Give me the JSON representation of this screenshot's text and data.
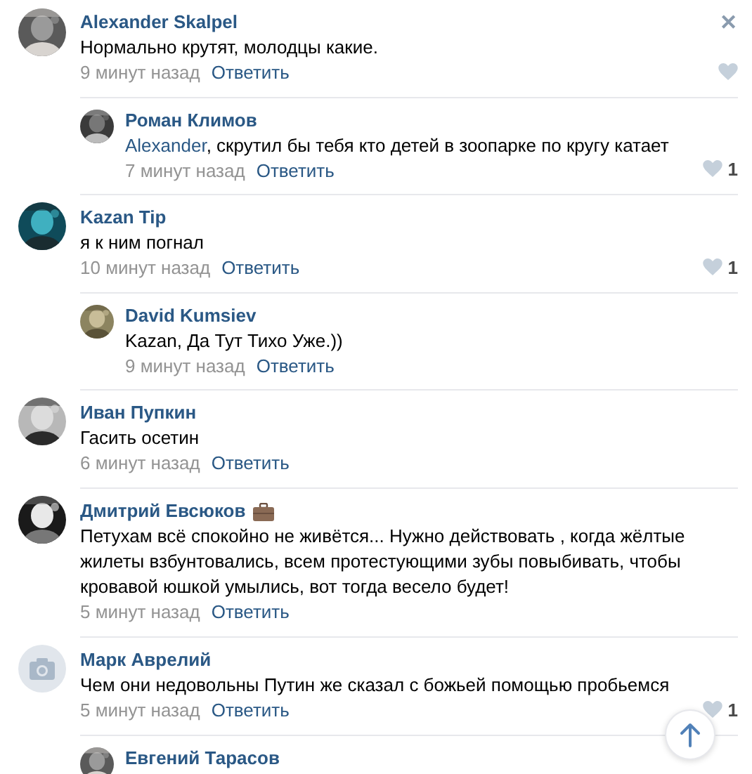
{
  "close_button": "✕",
  "comments": [
    {
      "author": "Alexander Skalpel",
      "text": "Нормально крутят, молодцы какие.",
      "time": "9 минут назад",
      "reply": "Ответить",
      "like_shown": true,
      "replies": [
        {
          "author": "Роман Климов",
          "mention": "Alexander",
          "text": ", скрутил бы тебя кто детей в зоопарке по кругу катает",
          "time": "7 минут назад",
          "reply": "Ответить",
          "like_shown": true,
          "like_count": "1"
        }
      ]
    },
    {
      "author": "Kazan Tip",
      "text": "я к ним погнал",
      "time": "10 минут назад",
      "reply": "Ответить",
      "like_shown": true,
      "like_count": "1",
      "replies": [
        {
          "author": "David Kumsiev",
          "text": "Kazan, Да Тут Тихо Уже.))",
          "time": "9 минут назад",
          "reply": "Ответить",
          "like_shown": false
        }
      ]
    },
    {
      "author": "Иван Пупкин",
      "text": "Гасить осетин",
      "time": "6 минут назад",
      "reply": "Ответить",
      "like_shown": false
    },
    {
      "author": "Дмитрий Евсюков",
      "author_badge": true,
      "text": "Петухам всё спокойно не живётся... Нужно действовать , когда жёлтые жилеты взбунтовались, всем протестующими зубы повыбивать, чтобы кровавой юшкой умылись, вот тогда весело будет!",
      "time": "5 минут назад",
      "reply": "Ответить",
      "like_shown": false
    },
    {
      "author": "Марк Аврелий",
      "avatar": {
        "kind": "camera"
      },
      "text": "Чем они недовольны Путин же сказал с божьей помощью пробьемся",
      "time": "5 минут назад",
      "reply": "Ответить",
      "like_shown": true,
      "like_count": "1",
      "replies": [
        {
          "author": "Евгений Тарасов"
        }
      ]
    }
  ]
}
